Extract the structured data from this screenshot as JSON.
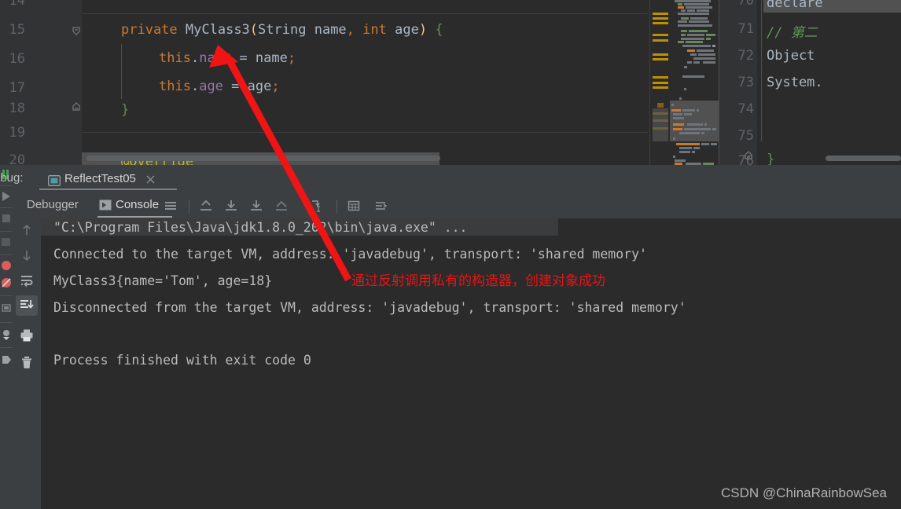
{
  "editor": {
    "line_numbers": [
      "14",
      "15",
      "16",
      "17",
      "18",
      "19",
      "20"
    ],
    "lines": [
      {
        "n": "14",
        "tokens": []
      },
      {
        "n": "15",
        "text": "private MyClass3(String name, int age) {"
      },
      {
        "n": "16",
        "text": "this.name = name;"
      },
      {
        "n": "17",
        "text": "this.age = age;"
      },
      {
        "n": "18",
        "text": "}"
      },
      {
        "n": "19",
        "text": ""
      },
      {
        "n": "20",
        "text": "@Override"
      }
    ],
    "code": {
      "l15_kw_private": "private",
      "l15_class": "MyClass3",
      "l15_paren_open": "(",
      "l15_type_string": "String",
      "l15_param_name": "name",
      "l15_comma": ",",
      "l15_kw_int": "int",
      "l15_param_age": "age",
      "l15_paren_close": ")",
      "l15_brace": "{",
      "l16_this": "this",
      "l16_dot": ".",
      "l16_field": "name",
      "l16_eq": " = ",
      "l16_val": "name",
      "l16_semi": ";",
      "l17_this": "this",
      "l17_dot": ".",
      "l17_field": "age",
      "l17_eq": " = ",
      "l17_val": "age",
      "l17_semi": ";",
      "l18_brace": "}",
      "l20_annotation": "@Override"
    },
    "right_pane": {
      "line_numbers": [
        "70",
        "71",
        "72",
        "73",
        "74",
        "75",
        "76"
      ],
      "lines": [
        {
          "n": "70",
          "text": "declare"
        },
        {
          "n": "71",
          "text": "// 第二"
        },
        {
          "n": "72",
          "text": "Object"
        },
        {
          "n": "73",
          "text": "System."
        },
        {
          "n": "74",
          "text": ""
        },
        {
          "n": "75",
          "text": ""
        },
        {
          "n": "76",
          "text": "}"
        }
      ]
    }
  },
  "debug_panel": {
    "title": "ebug:",
    "tab": {
      "label": "ReflectTest05",
      "close_icon": "close-icon",
      "config_icon": "run-configuration-icon"
    },
    "sub_tabs": [
      {
        "label": "Debugger",
        "active": false,
        "icon": null
      },
      {
        "label": "Console",
        "active": true,
        "icon": "console-icon"
      }
    ],
    "toolbar_icons": [
      "menu-lines-icon",
      "step-out-icon",
      "step-into-icon",
      "force-step-into-icon",
      "step-over-icon",
      "run-to-cursor-icon",
      "evaluate-expression-icon",
      "threads-view-icon"
    ],
    "sidebar_icons": [
      "scroll-up-icon",
      "scroll-down-icon",
      "soft-wrap-icon",
      "scroll-to-end-icon",
      "print-icon",
      "clear-all-icon"
    ],
    "left_strip_icons": [
      "resume-program-icon",
      "pause-program-icon",
      "stop-icon",
      "view-breakpoints-icon",
      "mute-breakpoints-icon",
      "restore-layout-icon",
      "settings-icon",
      "pin-icon"
    ]
  },
  "console": {
    "lines": [
      {
        "text": "\"C:\\Program Files\\Java\\jdk1.8.0_202\\bin\\java.exe\" ...",
        "highlighted": true
      },
      {
        "text": "Connected to the target VM, address: 'javadebug', transport: 'shared memory'",
        "highlighted": false
      },
      {
        "text": "MyClass3{name='Tom', age=18}",
        "highlighted": false
      },
      {
        "text": "Disconnected from the target VM, address: 'javadebug', transport: 'shared memory'",
        "highlighted": false
      },
      {
        "text": "",
        "highlighted": false
      },
      {
        "text": "Process finished with exit code 0",
        "highlighted": false
      }
    ]
  },
  "annotation": {
    "text": "通过反射调用私有的构造器，创建对象成功",
    "color": "#e81414",
    "arrow_color": "#f01414"
  },
  "watermark": {
    "text": "CSDN @ChinaRainbowSea"
  },
  "colors": {
    "editor_bg": "#2b2b2b",
    "gutter_bg": "#313335",
    "panel_bg": "#3c3f41",
    "keyword": "#cc7832",
    "field": "#9876aa",
    "string": "#6a8759",
    "comment": "#629755",
    "annotation_token": "#bbb529",
    "bracket": "#ffc66d",
    "text": "#a9b7c6",
    "warning_stripe": "#bf9000"
  }
}
